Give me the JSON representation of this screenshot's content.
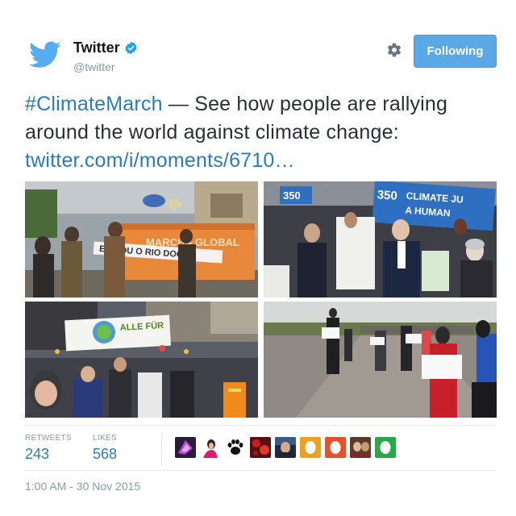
{
  "account": {
    "name": "Twitter",
    "handle": "@twitter",
    "verified": true,
    "brand_color": "#55acee"
  },
  "header": {
    "settings_icon": "gear-icon",
    "follow_button_label": "Following",
    "follow_button_color": "#5aa9e6"
  },
  "tweet": {
    "hashtag": "#ClimateMarch",
    "text": " — See how people are rallying around the world against climate change: ",
    "link": "twitter.com/i/moments/6710…",
    "link_color": "#2b7bb9"
  },
  "photos": {
    "photo_1": {
      "banner_text": "MARCHA GLOBAL",
      "sign_text": "EU SOU O RIO DOCE"
    },
    "photo_2": {
      "banner_text_1": "350",
      "banner_text_2": "CLIMATE JU",
      "banner_text_3": "A HUMAN"
    },
    "photo_3": {
      "banner_text": "ALLE FÜR"
    },
    "photo_4": {}
  },
  "stats": {
    "retweets_label": "RETWEETS",
    "retweets_value": "243",
    "likes_label": "LIKES",
    "likes_value": "568"
  },
  "likers": {
    "icons": [
      "avatar-icon",
      "avatar-icon",
      "paw-print-icon",
      "avatar-icon",
      "avatar-icon",
      "avatar-icon",
      "avatar-icon",
      "avatar-icon",
      "avatar-icon"
    ]
  },
  "timestamp": "1:00 AM - 30 Nov 2015"
}
